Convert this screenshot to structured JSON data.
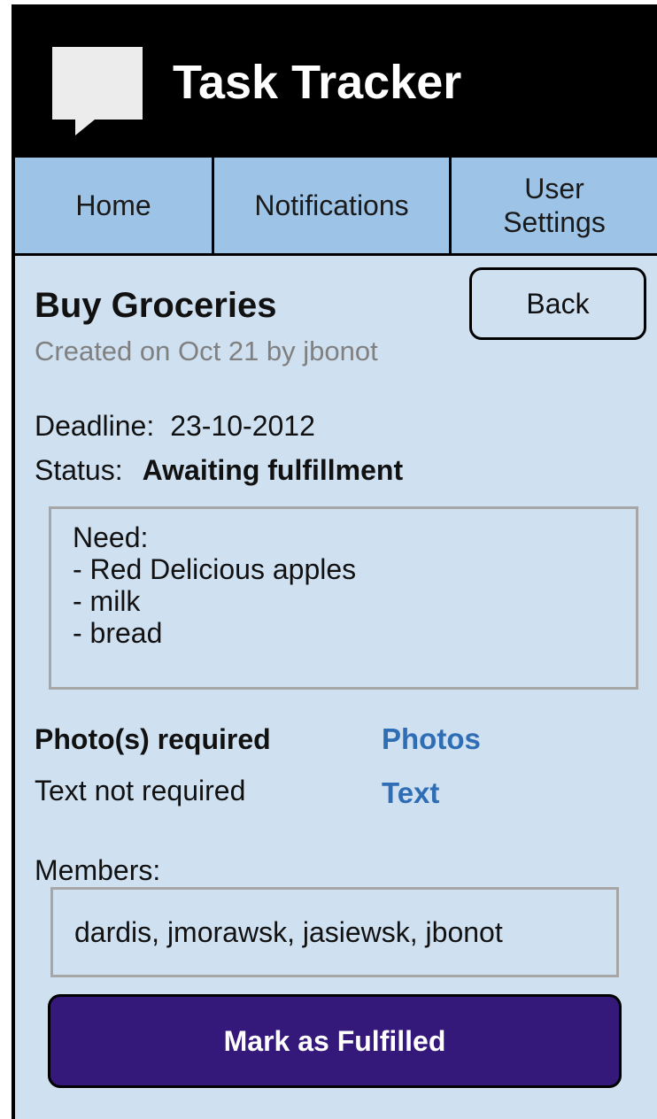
{
  "app": {
    "title": "Task Tracker",
    "logo_icon": "speech-bubble-icon"
  },
  "nav": {
    "tabs": [
      {
        "label": "Home"
      },
      {
        "label": "Notifications"
      },
      {
        "label": "User\nSettings"
      }
    ]
  },
  "task": {
    "title": "Buy Groceries",
    "created": "Created on Oct 21 by jbonot",
    "back_label": "Back",
    "deadline_label": "Deadline:",
    "deadline_value": "23-10-2012",
    "status_label": "Status:",
    "status_value": "Awaiting fulfillment",
    "notes": "Need:\n- Red Delicious apples\n- milk\n- bread",
    "photo_requirement": "Photo(s) required",
    "photo_link": "Photos",
    "text_requirement": "Text not required",
    "text_link": "Text",
    "members_label": "Members:",
    "members": "dardis, jmorawsk, jasiewsk, jbonot",
    "fulfill_label": "Mark as Fulfilled"
  },
  "colors": {
    "header_bg": "#000000",
    "nav_bg": "#9dc3e6",
    "page_bg": "#cfe0f1",
    "link": "#2f6db5",
    "primary_button": "#34187a"
  }
}
